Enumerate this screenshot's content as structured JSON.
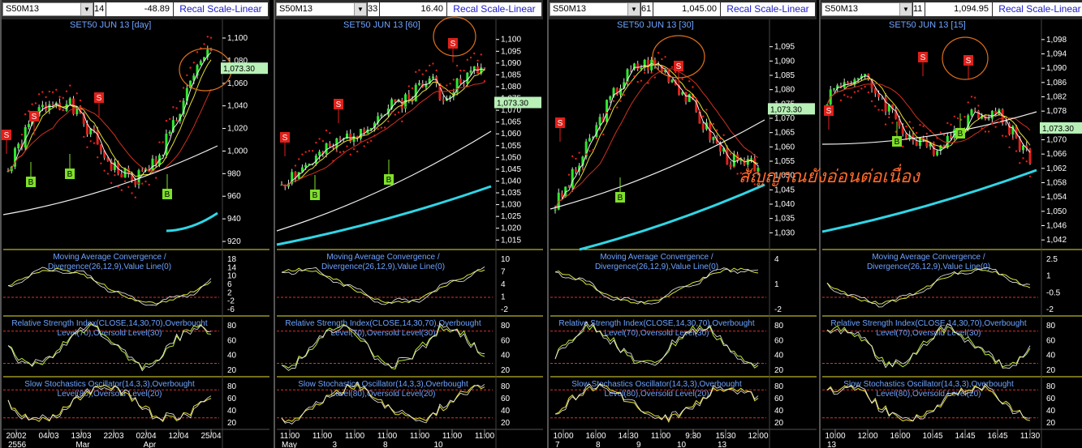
{
  "colors": {
    "accent": "#6ea3ff",
    "sell": "#e0201a",
    "buy": "#7fe02a",
    "macd": "#d8e63a",
    "rsi": "#b8e63a",
    "cyan": "#30d6e6",
    "red": "#d03020",
    "white": "#f0f0f0",
    "yellow": "#e8e030",
    "price_label_bg": "#b8f0b8",
    "circle": "#e0701a"
  },
  "annotation": "สัญญาณยังอ่อนต่อเนื่อง",
  "panes": [
    {
      "symbol": "S50M13",
      "count": "14",
      "last": "-48.89",
      "recal_label": "Recal Scale-Linear",
      "title": "SET50 JUN 13   [day]",
      "current_price": "1,073.30",
      "price_ticks": [
        "1,100",
        "1,080",
        "1,060",
        "1,040",
        "1,020",
        "1,000",
        "980",
        "960",
        "940",
        "920"
      ],
      "price_range": [
        915,
        1105
      ],
      "macd_title": [
        "Moving Average Convergence /",
        "Divergence(26,12,9),Value Line(0)"
      ],
      "macd_ticks": [
        "18",
        "14",
        "10",
        "6",
        "2",
        "-2",
        "-6"
      ],
      "rsi_title": [
        "Relative Strength Index(CLOSE,14,30,70),Overbought",
        "Level(70),Oversold Level(30)"
      ],
      "rsi_ticks": [
        "80",
        "60",
        "40",
        "20"
      ],
      "stoch_title": [
        "Slow Stochastics Oscillator(14,3,3),Overbought",
        "Level(80),Oversold Level(20)"
      ],
      "stoch_ticks": [
        "80",
        "60",
        "40",
        "20"
      ],
      "dates": [
        "20/02",
        "04/03",
        "13/03",
        "22/03",
        "02/04",
        "12/04",
        "25/04"
      ],
      "months": [
        "2556",
        "Mar",
        "Apr"
      ],
      "signals": [
        [
          "S",
          8,
          160
        ],
        [
          "S",
          42,
          137
        ],
        [
          "B",
          38,
          218
        ],
        [
          "B",
          86,
          208
        ],
        [
          "S",
          122,
          114
        ],
        [
          "B",
          206,
          233
        ]
      ],
      "circle": [
        253,
        86,
        32,
        26
      ],
      "seed": 1
    },
    {
      "symbol": "S50M13",
      "count": "33",
      "last": "16.40",
      "recal_label": "Recal Scale-Linear",
      "title": "SET50 JUN 13   [60]",
      "current_price": "1,073.30",
      "price_ticks": [
        "1,100",
        "1,095",
        "1,090",
        "1,085",
        "1,080",
        "1,075",
        "1,070",
        "1,065",
        "1,060",
        "1,055",
        "1,050",
        "1,045",
        "1,040",
        "1,035",
        "1,030",
        "1,025",
        "1,020",
        "1,015"
      ],
      "price_range": [
        1012,
        1103
      ],
      "macd_title": [
        "Moving Average Convergence /",
        "Divergence(26,12,9),Value Line(0)"
      ],
      "macd_ticks": [
        "10",
        "7",
        "4",
        "1",
        "-2"
      ],
      "rsi_title": [
        "Relative Strength Index(CLOSE,14,30,70),Overbought",
        "Level(70),Oversold Level(30)"
      ],
      "rsi_ticks": [
        "80",
        "60",
        "40",
        "20"
      ],
      "stoch_title": [
        "Slow Stochastics Oscillator(14,3,3),Overbought",
        "Level(80),Oversold Level(20)"
      ],
      "stoch_ticks": [
        "80",
        "60",
        "40",
        "20"
      ],
      "dates": [
        "11:00",
        "11:00",
        "11:00",
        "11:00",
        "11:00",
        "11:00",
        "11:00"
      ],
      "months": [
        "May",
        "3",
        "8",
        "10"
      ],
      "signals": [
        [
          "S",
          14,
          163
        ],
        [
          "S",
          80,
          122
        ],
        [
          "B",
          51,
          234
        ],
        [
          "B",
          142,
          215
        ],
        [
          "S",
          221,
          47
        ]
      ],
      "circle": [
        223,
        45,
        26,
        24
      ],
      "seed": 2
    },
    {
      "symbol": "S50M13",
      "count": "61",
      "last": "1,045.00",
      "recal_label": "Recal Scale-Linear",
      "title": "SET50 JUN 13   [30]",
      "current_price": "1,073.30",
      "price_ticks": [
        "1,095",
        "1,090",
        "1,085",
        "1,080",
        "1,075",
        "1,070",
        "1,065",
        "1,060",
        "1,055",
        "1,050",
        "1,045",
        "1,040",
        "1,035",
        "1,030"
      ],
      "price_range": [
        1025,
        1100
      ],
      "macd_title": [
        "Moving Average Convergence /",
        "Divergence(26,12,9),Value Line(0)"
      ],
      "macd_ticks": [
        "4",
        "1",
        "-2"
      ],
      "rsi_title": [
        "Relative Strength Index(CLOSE,14,30,70),Overbought",
        "Level(70),Oversold Level(30)"
      ],
      "rsi_ticks": [
        "80",
        "60",
        "40",
        "20"
      ],
      "stoch_title": [
        "Slow Stochastics Oscillator(14,3,3),Overbought",
        "Level(80),Oversold Level(20)"
      ],
      "stoch_ticks": [
        "80",
        "60",
        "40",
        "20"
      ],
      "dates": [
        "10:00",
        "16:00",
        "14:30",
        "11:00",
        "9:30",
        "15:30",
        "12:00"
      ],
      "months": [
        "7",
        "8",
        "9",
        "10",
        "13"
      ],
      "signals": [
        [
          "S",
          16,
          145
        ],
        [
          "B",
          90,
          237
        ],
        [
          "S",
          162,
          75
        ]
      ],
      "circle": [
        162,
        70,
        32,
        26
      ],
      "seed": 3
    },
    {
      "symbol": "S50M13",
      "count": "11",
      "last": "1,094.95",
      "recal_label": "Recal Scale-Linear",
      "title": "SET50 JUN 13   [15]",
      "current_price": "1,073.30",
      "price_ticks": [
        "1,098",
        "1,094",
        "1,090",
        "1,086",
        "1,082",
        "1,078",
        "1,074",
        "1,070",
        "1,066",
        "1,062",
        "1,058",
        "1,054",
        "1,050",
        "1,046",
        "1,042"
      ],
      "price_range": [
        1040,
        1100
      ],
      "macd_title": [
        "Moving Average Convergence /",
        "Divergence(26,12,9),Value Line(0)"
      ],
      "macd_ticks": [
        "2.5",
        "1",
        "-0.5",
        "-2"
      ],
      "rsi_title": [
        "Relative Strength Index(CLOSE,14,30,70),Overbought",
        "Level(70),Oversold Level(30)"
      ],
      "rsi_ticks": [
        "80",
        "60",
        "40",
        "20"
      ],
      "stoch_title": [
        "Slow Stochastics Oscillator(14,3,3),Overbought",
        "Level(80),Oversold Level(20)"
      ],
      "stoch_ticks": [
        "80",
        "60",
        "40",
        "20"
      ],
      "dates": [
        "10:00",
        "12:00",
        "16:00",
        "10:45",
        "14:45",
        "16:45",
        "11:30"
      ],
      "months": [
        "13"
      ],
      "signals": [
        [
          "S",
          12,
          130
        ],
        [
          "B",
          96,
          168
        ],
        [
          "S",
          128,
          64
        ],
        [
          "S",
          184,
          68
        ],
        [
          "B",
          174,
          158
        ]
      ],
      "circle": [
        180,
        72,
        28,
        26
      ],
      "seed": 4
    }
  ]
}
